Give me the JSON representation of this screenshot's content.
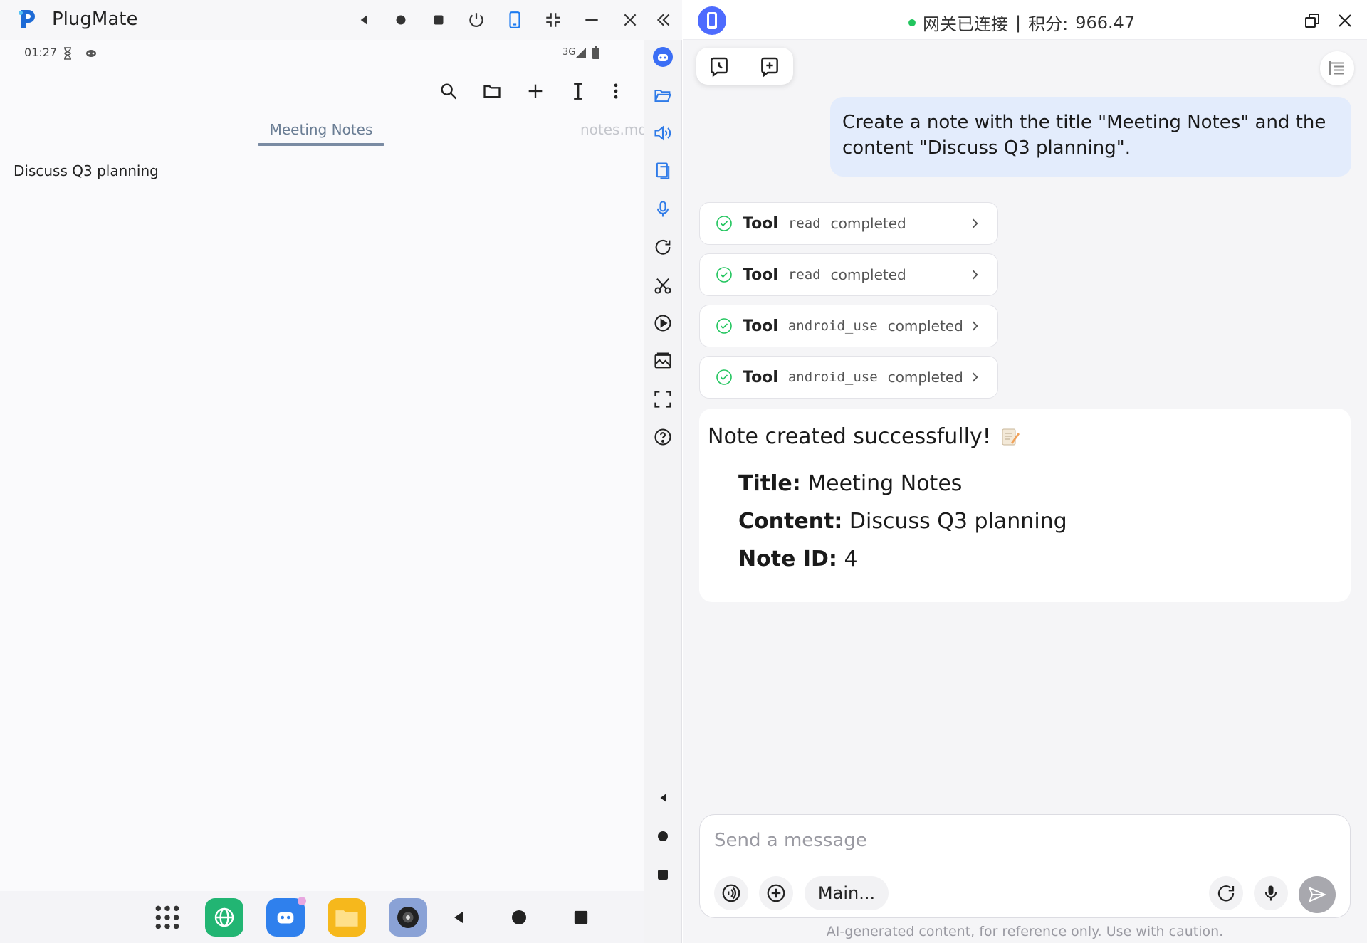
{
  "window": {
    "app_title": "PlugMate",
    "icons": [
      "back-icon",
      "home-icon",
      "recents-icon",
      "power-icon",
      "phone-icon",
      "shrink-icon",
      "minimize-icon",
      "close-icon",
      "collapse-icon"
    ]
  },
  "phone": {
    "status_time": "01:27",
    "status_network": "3G",
    "toolbar_icons": [
      "search-icon",
      "folder-icon",
      "add-icon",
      "text-cursor-icon",
      "more-icon"
    ],
    "tabs": [
      {
        "label": "Meeting Notes",
        "active": true
      },
      {
        "label": "notes.md",
        "active": false
      }
    ],
    "note_content": "Discuss Q3 planning",
    "dock_apps": [
      "app-drawer-icon",
      "browser-icon",
      "robot-app-icon",
      "files-app-icon",
      "camera-app-icon"
    ],
    "nav": [
      "back-icon",
      "home-icon",
      "recents-icon"
    ]
  },
  "sidebar": {
    "icons": [
      "robot-icon",
      "folder-open-icon",
      "volume-icon",
      "copy-icon",
      "mic-icon",
      "rotate-icon",
      "scissors-icon",
      "play-icon",
      "gallery-icon",
      "fullscreen-icon",
      "help-icon"
    ],
    "bottom_icons": [
      "back-icon",
      "home-icon",
      "recents-icon"
    ]
  },
  "chat": {
    "gateway_status": "网关已连接",
    "separator": "|",
    "points_label": "积分:",
    "points_value": "966.47",
    "user_message": "Create a note with the title \"Meeting Notes\" and the content \"Discuss Q3 planning\".",
    "tools": [
      {
        "word": "Tool",
        "name": "read",
        "state": "completed"
      },
      {
        "word": "Tool",
        "name": "read",
        "state": "completed"
      },
      {
        "word": "Tool",
        "name": "android_use",
        "state": "completed"
      },
      {
        "word": "Tool",
        "name": "android_use",
        "state": "completed"
      }
    ],
    "result": {
      "headline": "Note created successfully!",
      "title_label": "Title:",
      "title_value": "Meeting Notes",
      "content_label": "Content:",
      "content_value": "Discuss Q3 planning",
      "id_label": "Note ID:",
      "id_value": "4"
    },
    "composer": {
      "placeholder": "Send a message",
      "model_label": "Main..."
    },
    "disclaimer": "AI-generated content, for reference only. Use with caution."
  },
  "colors": {
    "accent": "#4d6bfe",
    "success": "#22c55e",
    "user_bubble": "#e3ecfc"
  }
}
